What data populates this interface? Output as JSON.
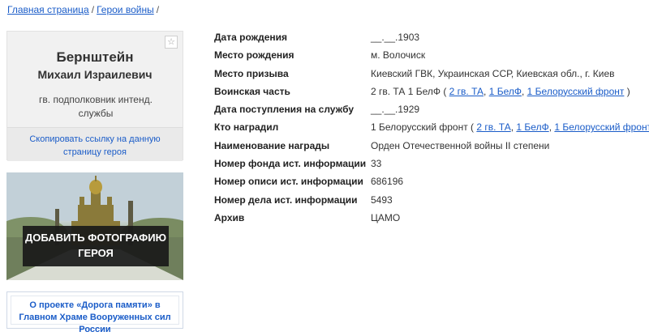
{
  "breadcrumb": {
    "home": "Главная страница",
    "section": "Герои войны",
    "separator": "/"
  },
  "hero_card": {
    "surname": "Бернштейн",
    "given_names": "Михаил Израилевич",
    "rank": "гв. подполковник интенд. службы",
    "favorite_icon": "star-outline",
    "copy_link_label": "Скопировать ссылку на данную страницу героя"
  },
  "photo_block": {
    "button_label": "Добавить фотографию героя"
  },
  "project_link": {
    "label": "О проекте «Дорога памяти» в Главном Храме Вооруженных сил России"
  },
  "info": {
    "birth_date": {
      "label": "Дата рождения",
      "value": "__.__.1903"
    },
    "birth_place": {
      "label": "Место рождения",
      "value": "м. Волочиск"
    },
    "draft_place": {
      "label": "Место призыва",
      "value": "Киевский ГВК, Украинская ССР, Киевская обл., г. Киев"
    },
    "unit": {
      "label": "Воинская часть",
      "prefix": "2 гв. ТА 1 БелФ ( ",
      "links": [
        "2 гв. ТА",
        "1 БелФ",
        "1 Белорусский фронт"
      ],
      "sep": ", ",
      "suffix": " )"
    },
    "service_date": {
      "label": "Дата поступления на службу",
      "value": "__.__.1929"
    },
    "awarded_by": {
      "label": "Кто наградил",
      "prefix": "1 Белорусский фронт ( ",
      "links": [
        "2 гв. ТА",
        "1 БелФ",
        "1 Белорусский фронт"
      ],
      "sep": ", ",
      "suffix": " )"
    },
    "award_name": {
      "label": "Наименование награды",
      "value": "Орден Отечественной войны II степени"
    },
    "fund_number": {
      "label": "Номер фонда ист. информации",
      "value": "33"
    },
    "inventory_number": {
      "label": "Номер описи ист. информации",
      "value": "686196"
    },
    "case_number": {
      "label": "Номер дела ист. информации",
      "value": "5493"
    },
    "archive": {
      "label": "Архив",
      "value": "ЦАМО"
    }
  },
  "colors": {
    "link": "#1a5cc8",
    "card_bg": "#f1f1f1",
    "overlay_bg": "#191919"
  }
}
